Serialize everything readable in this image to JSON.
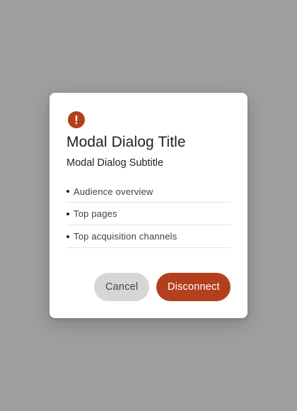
{
  "dialog": {
    "icon": "alert-circle-icon",
    "title": "Modal Dialog Title",
    "subtitle": "Modal Dialog Subtitle",
    "items": [
      {
        "label": "Audience overview"
      },
      {
        "label": "Top pages"
      },
      {
        "label": "Top acquisition channels"
      }
    ],
    "cancel_label": "Cancel",
    "confirm_label": "Disconnect"
  },
  "colors": {
    "accent": "#b3401c",
    "scrim": "#9e9e9e",
    "cancel_bg": "#d6d6d6",
    "surface": "#ffffff"
  }
}
